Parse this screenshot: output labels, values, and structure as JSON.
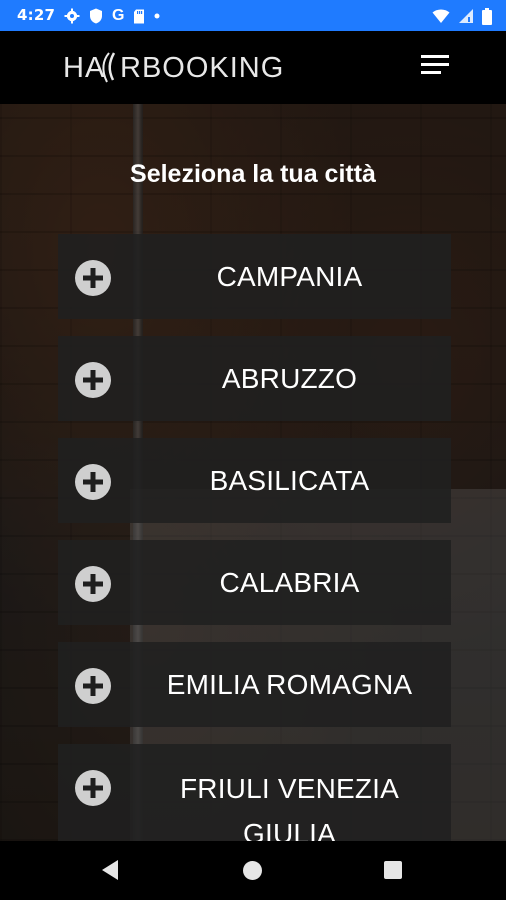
{
  "status_bar": {
    "time": "4:27",
    "left_icons": [
      "gear-icon",
      "shield-icon",
      "google-g-icon",
      "sd-card-icon",
      "dot-icon"
    ],
    "right_icons": [
      "wifi-icon",
      "signal-icon",
      "battery-icon"
    ],
    "google_letter": "G",
    "background_color": "#1f7bff"
  },
  "header": {
    "logo_text": "HAIRBOOKING",
    "menu_icon": "hamburger-menu-icon"
  },
  "main": {
    "title": "Seleziona la tua città",
    "regions": [
      {
        "label": "CAMPANIA"
      },
      {
        "label": "ABRUZZO"
      },
      {
        "label": "BASILICATA"
      },
      {
        "label": "CALABRIA"
      },
      {
        "label": "EMILIA ROMAGNA"
      },
      {
        "label": "FRIULI VENEZIA GIULIA"
      }
    ]
  },
  "nav_bar": {
    "icons": [
      "back-icon",
      "home-icon",
      "recent-apps-icon"
    ]
  }
}
